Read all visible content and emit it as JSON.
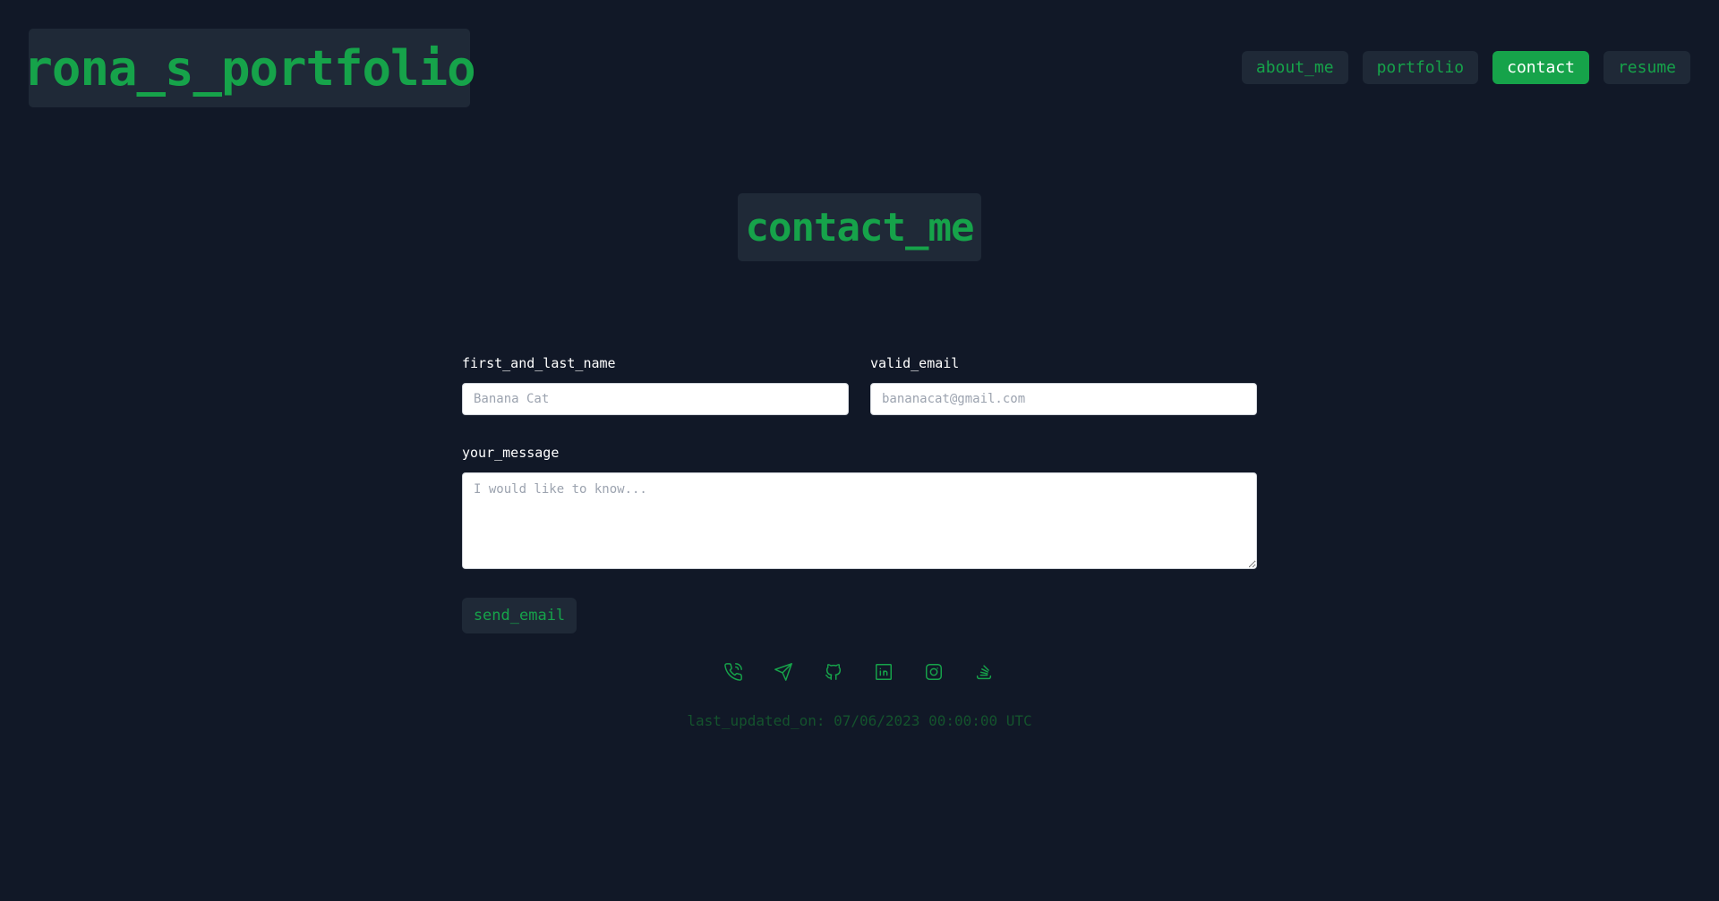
{
  "header": {
    "logo": "rona_s_portfolio",
    "nav": [
      {
        "label": "about_me",
        "active": false
      },
      {
        "label": "portfolio",
        "active": false
      },
      {
        "label": "contact",
        "active": true
      },
      {
        "label": "resume",
        "active": false
      }
    ]
  },
  "main": {
    "title": "contact_me",
    "form": {
      "name_label": "first_and_last_name",
      "name_placeholder": "Banana Cat",
      "email_label": "valid_email",
      "email_placeholder": "bananacat@gmail.com",
      "message_label": "your_message",
      "message_placeholder": "I would like to know...",
      "submit_label": "send_email"
    },
    "social_icons": [
      "phone-icon",
      "send-icon",
      "github-icon",
      "linkedin-icon",
      "instagram-icon",
      "stack-overflow-icon"
    ]
  },
  "footer": {
    "last_updated": "last_updated_on: 07/06/2023 00:00:00 UTC"
  },
  "colors": {
    "background": "#111827",
    "panel": "#1f2937",
    "accent": "#16a34a"
  }
}
